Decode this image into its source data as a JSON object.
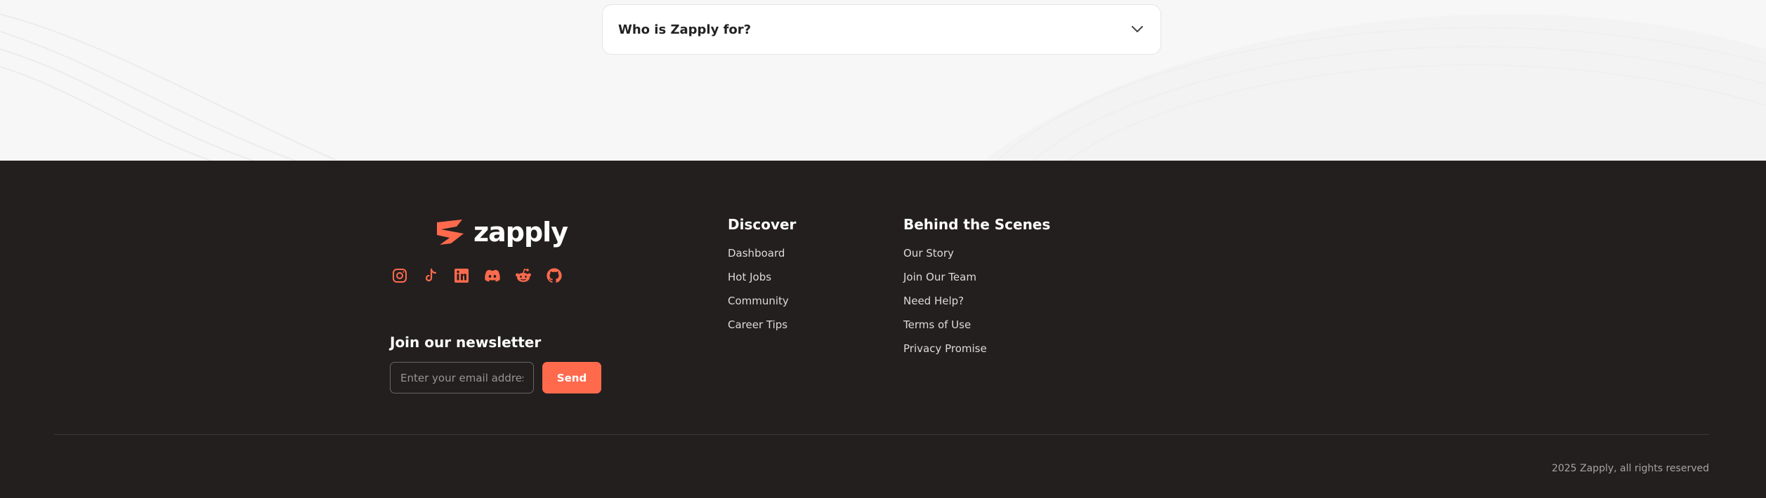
{
  "faq": {
    "question": "Who is Zapply for?",
    "expand_icon": "chevron-down-icon"
  },
  "footer": {
    "brand": {
      "name": "zapply",
      "mark_icon": "zapply-mark-icon",
      "accent": "#ff6a4d"
    },
    "socials": [
      {
        "icon": "instagram-icon"
      },
      {
        "icon": "tiktok-icon"
      },
      {
        "icon": "linkedin-icon"
      },
      {
        "icon": "discord-icon"
      },
      {
        "icon": "reddit-icon"
      },
      {
        "icon": "github-icon"
      }
    ],
    "newsletter": {
      "title": "Join our newsletter",
      "placeholder": "Enter your email address",
      "send_label": "Send"
    },
    "discover": {
      "title": "Discover",
      "links": [
        "Dashboard",
        "Hot Jobs",
        "Community",
        "Career Tips"
      ]
    },
    "behind": {
      "title": "Behind the Scenes",
      "links": [
        "Our Story",
        "Join Our Team",
        "Need Help?",
        "Terms of Use",
        "Privacy Promise"
      ]
    },
    "copyright": "2025 Zapply, all rights reserved"
  },
  "colors": {
    "footer_bg": "#231f1f",
    "page_bg": "#f8f7f7",
    "accent": "#ff6a4d"
  }
}
